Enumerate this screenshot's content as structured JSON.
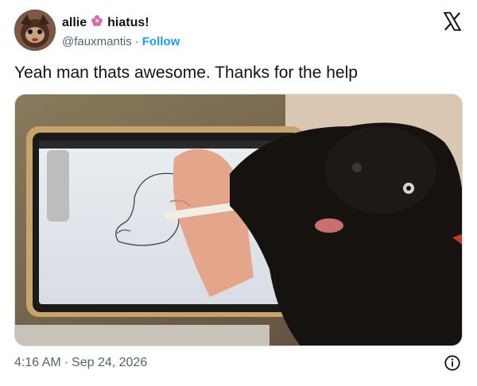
{
  "author": {
    "display_name": "allie",
    "emoji": "flower-emoji",
    "status": "hiatus!",
    "handle": "@fauxmantis",
    "follow_label": "Follow"
  },
  "tweet": {
    "text": "Yeah man thats awesome. Thanks for the help",
    "time": "4:16 AM",
    "date": "Sep 24, 2026"
  },
  "icons": {
    "close": "x-logo-icon",
    "info": "info-icon"
  },
  "colors": {
    "link": "#1d9bf0",
    "muted": "#536471",
    "text": "#0f1419"
  }
}
